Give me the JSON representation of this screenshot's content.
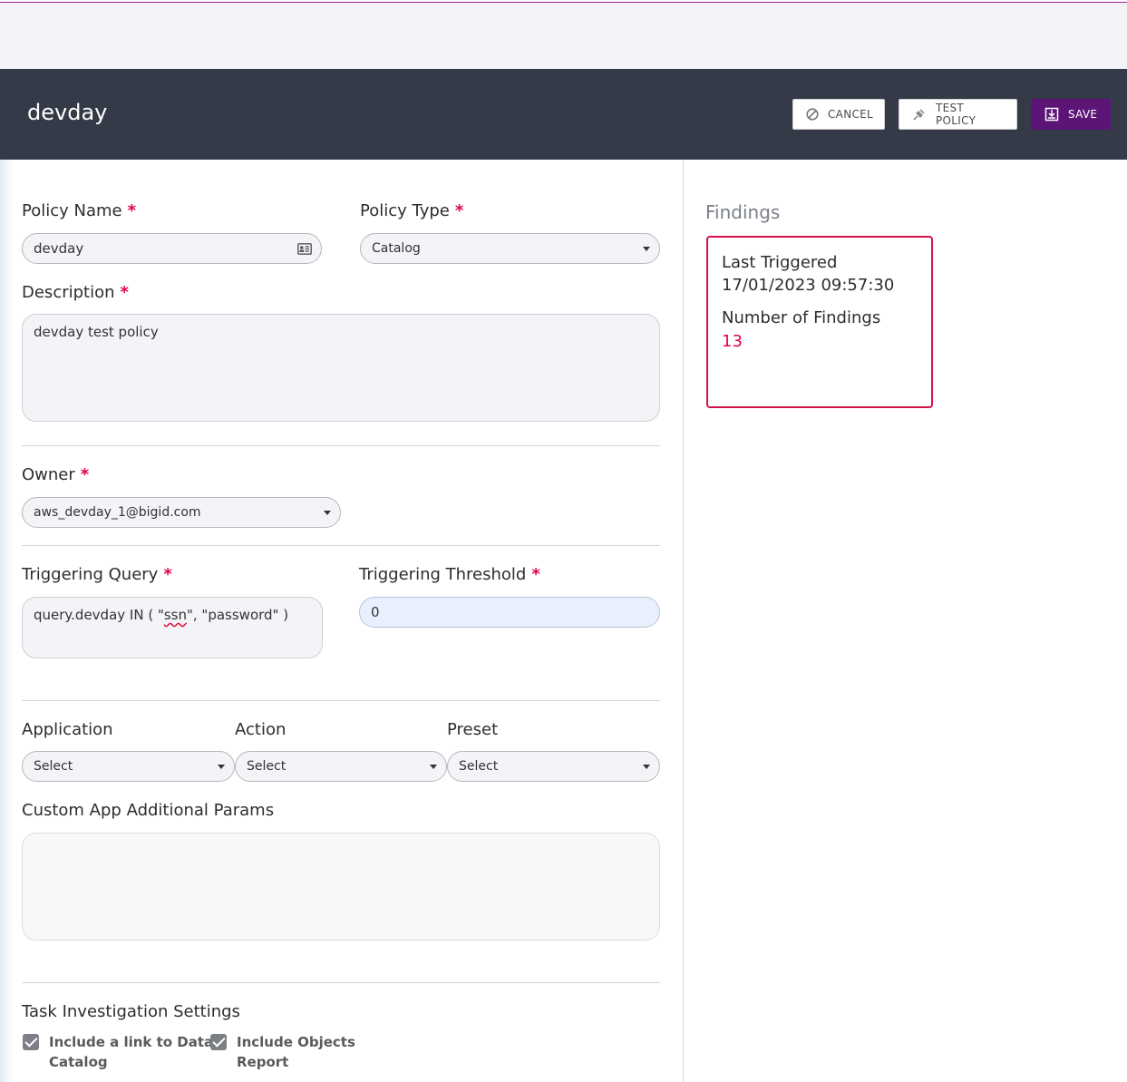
{
  "header": {
    "title": "devday",
    "cancel_label": "CANCEL",
    "test_policy_label": "TEST POLICY",
    "save_label": "SAVE"
  },
  "form": {
    "policy_name": {
      "label": "Policy Name",
      "value": "devday"
    },
    "policy_type": {
      "label": "Policy Type",
      "value": "Catalog"
    },
    "description": {
      "label": "Description",
      "value": "devday test policy"
    },
    "owner": {
      "label": "Owner",
      "value": "aws_devday_1@bigid.com"
    },
    "triggering_query": {
      "label": "Triggering Query",
      "value_prefix": "query.devday IN ( \"",
      "value_ssn": "ssn",
      "value_suffix": "\", \"password\" )"
    },
    "triggering_threshold": {
      "label": "Triggering Threshold",
      "value": "0"
    },
    "application": {
      "label": "Application",
      "value": "Select"
    },
    "action": {
      "label": "Action",
      "value": "Select"
    },
    "preset": {
      "label": "Preset",
      "value": "Select"
    },
    "custom_params": {
      "label": "Custom App Additional Params",
      "value": ""
    },
    "task_settings": {
      "label": "Task Investigation Settings",
      "include_link": {
        "label_line1": "Include a link to Data",
        "label_line2": "Catalog",
        "checked": true
      },
      "include_objects": {
        "label_line1": "Include Objects",
        "label_line2": "Report",
        "checked": true
      }
    },
    "required_mark": "*"
  },
  "findings": {
    "title": "Findings",
    "last_triggered_label": "Last Triggered",
    "last_triggered_value": "17/01/2023 09:57:30",
    "number_label": "Number of Findings",
    "number_value": "13"
  },
  "colors": {
    "header_bg": "#343a47",
    "save_bg": "#5c1577",
    "required": "#e0004b",
    "findings_border": "#d6124a"
  }
}
